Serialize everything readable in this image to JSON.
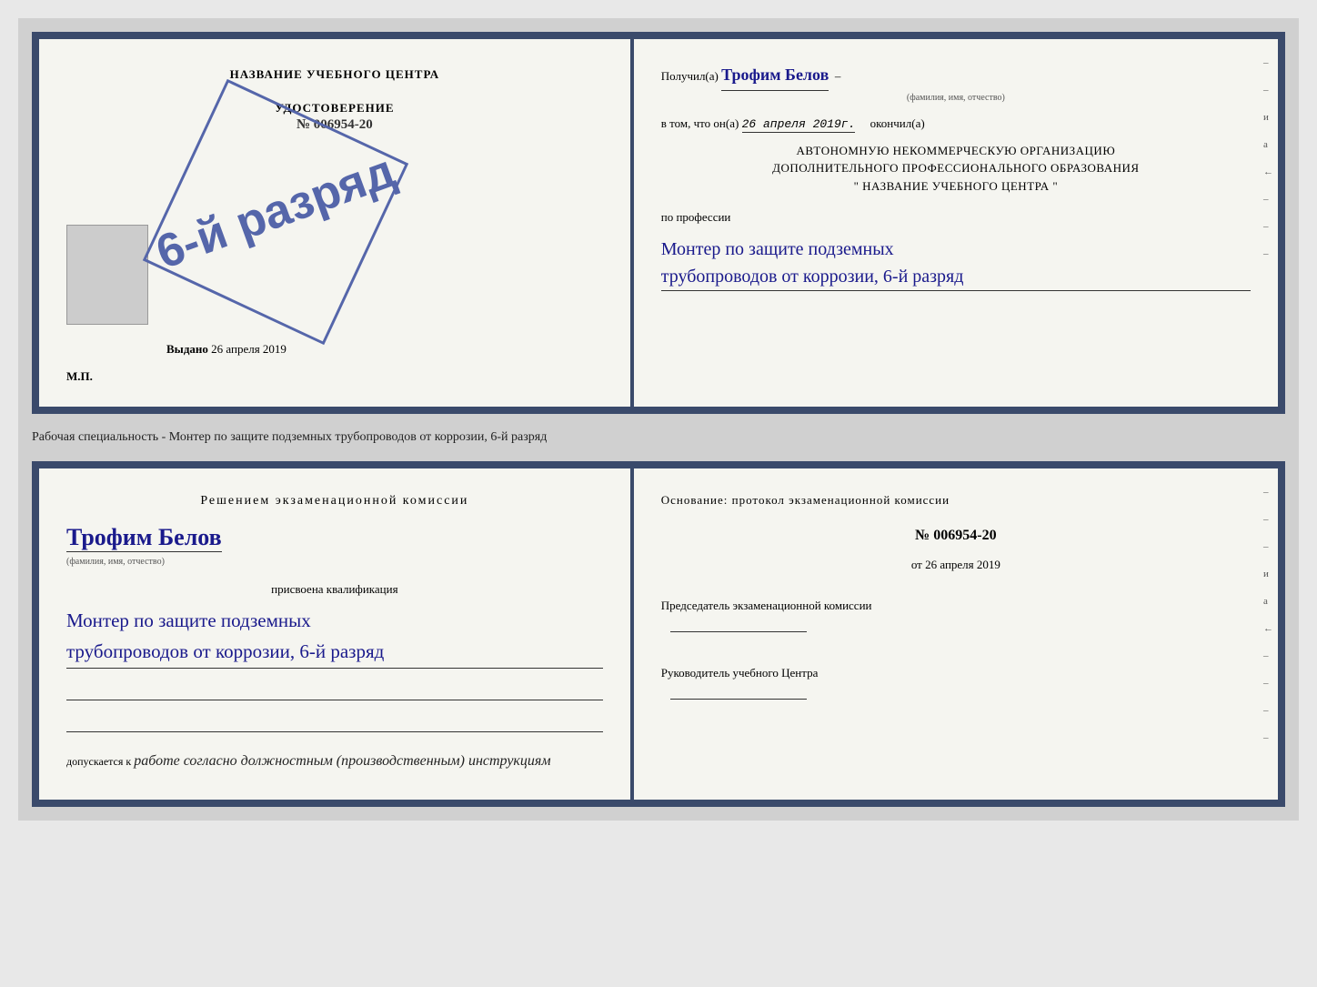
{
  "top_doc": {
    "left": {
      "center_title": "НАЗВАНИЕ УЧЕБНОГО ЦЕНТРА",
      "cert_label": "УДОСТОВЕРЕНИЕ",
      "cert_number": "№ 006954-20",
      "stamp_text": "6-й разряд",
      "issued_label": "Выдано",
      "issued_date": "26 апреля 2019",
      "mp_label": "М.П."
    },
    "right": {
      "received_prefix": "Получил(а)",
      "recipient_name": "Трофим Белов",
      "name_hint": "(фамилия, имя, отчество)",
      "date_prefix": "в том, что он(а)",
      "date_value": "26 апреля 2019г.",
      "date_suffix": "окончил(а)",
      "org_line1": "АВТОНОМНУЮ НЕКОММЕРЧЕСКУЮ ОРГАНИЗАЦИЮ",
      "org_line2": "ДОПОЛНИТЕЛЬНОГО ПРОФЕССИОНАЛЬНОГО ОБРАЗОВАНИЯ",
      "org_line3": "\"    НАЗВАНИЕ УЧЕБНОГО ЦЕНТРА    \"",
      "profession_label": "по профессии",
      "profession_line1": "Монтер по защите подземных",
      "profession_line2": "трубопроводов от коррозии, 6-й разряд",
      "side_marks": [
        "–",
        "–",
        "и",
        "а",
        "←",
        "–",
        "–",
        "–"
      ]
    }
  },
  "middle_text": "Рабочая специальность - Монтер по защите подземных трубопроводов от коррозии, 6-й разряд",
  "bottom_doc": {
    "left": {
      "decision_title": "Решением  экзаменационной  комиссии",
      "person_name": "Трофим Белов",
      "name_hint": "(фамилия, имя, отчество)",
      "assigned_label": "присвоена квалификация",
      "qualification_line1": "Монтер по защите подземных",
      "qualification_line2": "трубопроводов от коррозии, 6-й разряд",
      "permission_prefix": "допускается к",
      "permission_text": "работе согласно должностным (производственным) инструкциям"
    },
    "right": {
      "basis_label": "Основание:  протокол  экзаменационной  комиссии",
      "protocol_number": "№  006954-20",
      "date_prefix": "от",
      "date_value": "26 апреля 2019",
      "chairman_label": "Председатель экзаменационной комиссии",
      "director_label": "Руководитель учебного Центра",
      "side_marks": [
        "–",
        "–",
        "–",
        "и",
        "а",
        "←",
        "–",
        "–",
        "–",
        "–"
      ]
    }
  }
}
